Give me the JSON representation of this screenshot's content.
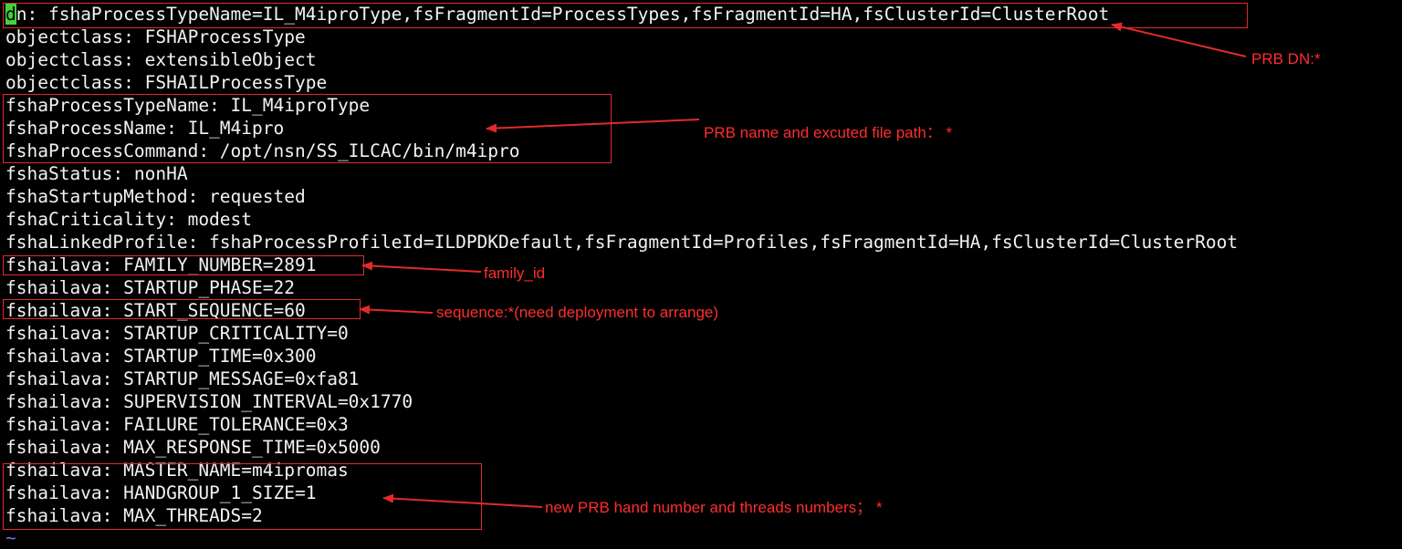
{
  "terminal": {
    "lines": [
      {
        "cursor": "d",
        "rest": "n: fshaProcessTypeName=IL_M4iproType,fsFragmentId=ProcessTypes,fsFragmentId=HA,fsClusterId=ClusterRoot"
      },
      {
        "text": "objectclass: FSHAProcessType"
      },
      {
        "text": "objectclass: extensibleObject"
      },
      {
        "text": "objectclass: FSHAILProcessType"
      },
      {
        "text": "fshaProcessTypeName: IL_M4iproType"
      },
      {
        "text": "fshaProcessName: IL_M4ipro"
      },
      {
        "text": "fshaProcessCommand: /opt/nsn/SS_ILCAC/bin/m4ipro"
      },
      {
        "text": "fshaStatus: nonHA"
      },
      {
        "text": "fshaStartupMethod: requested"
      },
      {
        "text": "fshaCriticality: modest"
      },
      {
        "text": "fshaLinkedProfile: fshaProcessProfileId=ILDPDKDefault,fsFragmentId=Profiles,fsFragmentId=HA,fsClusterId=ClusterRoot"
      },
      {
        "text": "fshailava: FAMILY_NUMBER=2891"
      },
      {
        "text": "fshailava: STARTUP_PHASE=22"
      },
      {
        "text": "fshailava: START_SEQUENCE=60"
      },
      {
        "text": "fshailava: STARTUP_CRITICALITY=0"
      },
      {
        "text": "fshailava: STARTUP_TIME=0x300"
      },
      {
        "text": "fshailava: STARTUP_MESSAGE=0xfa81"
      },
      {
        "text": "fshailava: SUPERVISION_INTERVAL=0x1770"
      },
      {
        "text": "fshailava: FAILURE_TOLERANCE=0x3"
      },
      {
        "text": "fshailava: MAX_RESPONSE_TIME=0x5000"
      },
      {
        "text": "fshailava: MASTER_NAME=m4ipromas"
      },
      {
        "text": "fshailava: HANDGROUP_1_SIZE=1"
      },
      {
        "text": "fshailava: MAX_THREADS=2"
      }
    ],
    "empty_line_marker": "~"
  },
  "annotations": {
    "dn": "PRB DN:*",
    "name_path": "PRB name and excuted file path： *",
    "family": "family_id",
    "sequence": "sequence:*(need deployment to arrange)",
    "handgroup": "new PRB hand number and threads numbers； *"
  },
  "colors": {
    "background": "#000000",
    "text": "#f2f2f2",
    "cursor": "#3fd43f",
    "annotation": "#ff2d2d",
    "tilde": "#6d6de0"
  }
}
